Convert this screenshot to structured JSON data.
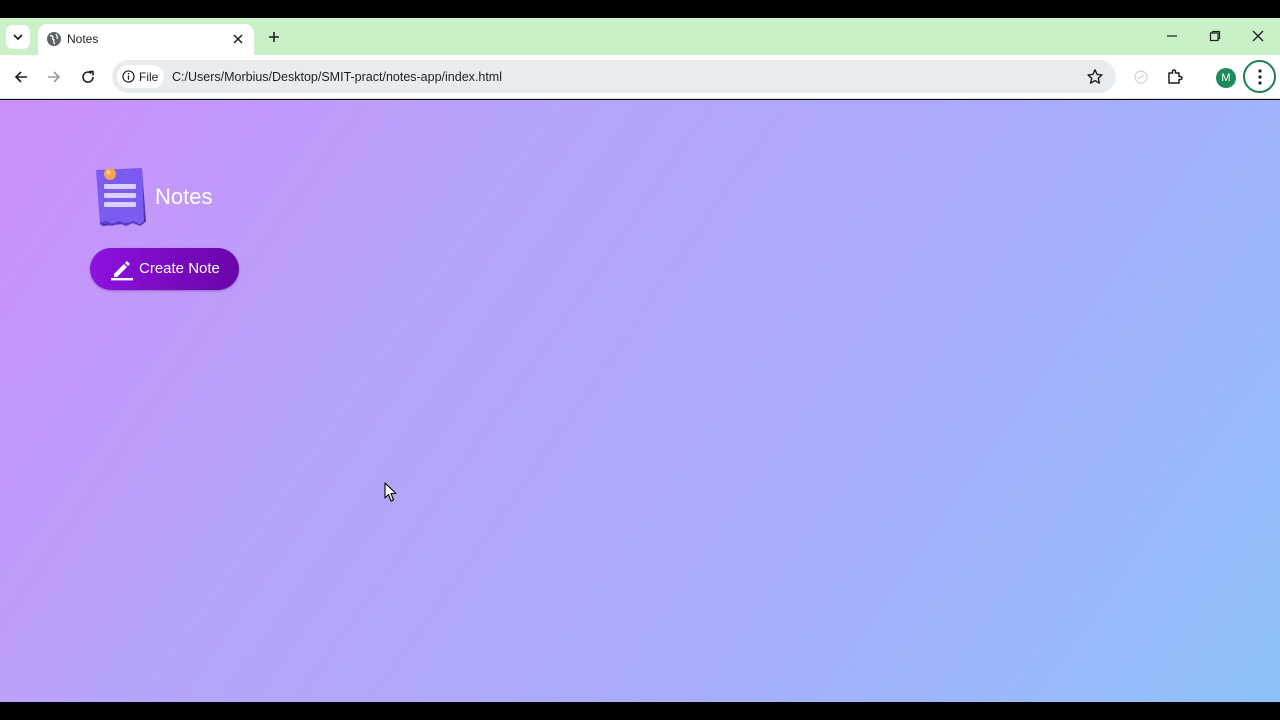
{
  "browser": {
    "tab_title": "Notes",
    "site_chip_label": "File",
    "url": "C:/Users/Morbius/Desktop/SMIT-pract/notes-app/index.html",
    "profile_initial": "M",
    "icons": [
      "tab-search-icon",
      "globe-icon",
      "close-icon",
      "plus-icon",
      "minimize-icon",
      "restore-icon",
      "back-icon",
      "forward-icon",
      "reload-icon",
      "info-icon",
      "star-icon",
      "extensions-icon",
      "more-vert-icon"
    ]
  },
  "app": {
    "title": "Notes",
    "create_button_label": "Create Note",
    "colors": {
      "gradient_start": "#cb8ff9",
      "gradient_end": "#8ec2f9",
      "button_start": "#8d12df",
      "button_end": "#6a04a8"
    }
  }
}
